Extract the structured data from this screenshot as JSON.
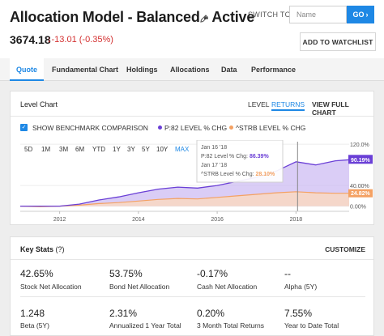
{
  "header": {
    "title": "Allocation Model - Balanced - Active",
    "price": "3674.18",
    "change": "↓-13.01 (-0.35%)",
    "switch_label": "SWITCH TO:",
    "switch_placeholder": "Name",
    "go_label": "GO",
    "watchlist_label": "ADD TO WATCHLIST"
  },
  "tabs": [
    "Quote",
    "Fundamental Chart",
    "Holdings",
    "Allocations",
    "Data",
    "Performance"
  ],
  "chart_card": {
    "title": "Level Chart",
    "level_label": "LEVEL",
    "returns_label": "RETURNS",
    "full_chart_label": "VIEW FULL CHART",
    "benchmark_label": "SHOW BENCHMARK COMPARISON",
    "legend": [
      "P:82 LEVEL % CHG",
      "^STRB LEVEL % CHG"
    ],
    "ranges": [
      "5D",
      "1M",
      "3M",
      "6M",
      "YTD",
      "1Y",
      "3Y",
      "5Y",
      "10Y",
      "MAX"
    ],
    "active_range": "MAX",
    "tooltip": {
      "date1": "Jan 16 '18",
      "line1_prefix": "P:82 Level % Chg:",
      "line1_value": "86.39%",
      "date2": "Jan 17 '18",
      "line2_prefix": "^STRB Level % Chg:",
      "line2_value": "28.10%"
    },
    "end_labels": [
      "90.19%",
      "24.82%"
    ]
  },
  "chart_data": {
    "type": "area",
    "x": [
      2011.0,
      2011.5,
      2012.0,
      2012.5,
      2013.0,
      2013.5,
      2014.0,
      2014.5,
      2015.0,
      2015.5,
      2016.0,
      2016.5,
      2017.0,
      2017.5,
      2018.0,
      2018.5,
      2019.0,
      2019.35
    ],
    "series": [
      {
        "name": "P:82 LEVEL % CHG",
        "values": [
          0,
          0,
          0,
          4,
          12,
          18,
          26,
          33,
          37,
          35,
          40,
          48,
          56,
          68,
          86,
          80,
          88,
          90
        ]
      },
      {
        "name": "^STRB LEVEL % CHG",
        "values": [
          0,
          -1,
          0,
          2,
          5,
          7,
          10,
          13,
          15,
          14,
          17,
          20,
          23,
          26,
          28,
          26,
          25,
          25
        ]
      }
    ],
    "xticks": [
      "2012",
      "2014",
      "2016",
      "2018"
    ],
    "yticks": [
      "120.0%",
      "40.00%",
      "0.00%"
    ],
    "ylim": [
      -10,
      125
    ],
    "colors": {
      "p82": "#6a3fd6",
      "strb": "#f4a163",
      "accent": "#1e88e5",
      "down": "#d32f2f"
    }
  },
  "key_stats": {
    "title": "Key Stats",
    "help": "(?)",
    "customize_label": "CUSTOMIZE",
    "row1": [
      {
        "value": "42.65%",
        "label": "Stock Net Allocation"
      },
      {
        "value": "53.75%",
        "label": "Bond Net Allocation"
      },
      {
        "value": "-0.17%",
        "label": "Cash Net Allocation"
      },
      {
        "value": "--",
        "label": "Alpha (5Y)"
      }
    ],
    "row2": [
      {
        "value": "1.248",
        "label": "Beta (5Y)"
      },
      {
        "value": "2.31%",
        "label": "Annualized 1 Year Total"
      },
      {
        "value": "0.20%",
        "label": "3 Month Total Returns"
      },
      {
        "value": "7.55%",
        "label": "Year to Date Total"
      }
    ]
  }
}
